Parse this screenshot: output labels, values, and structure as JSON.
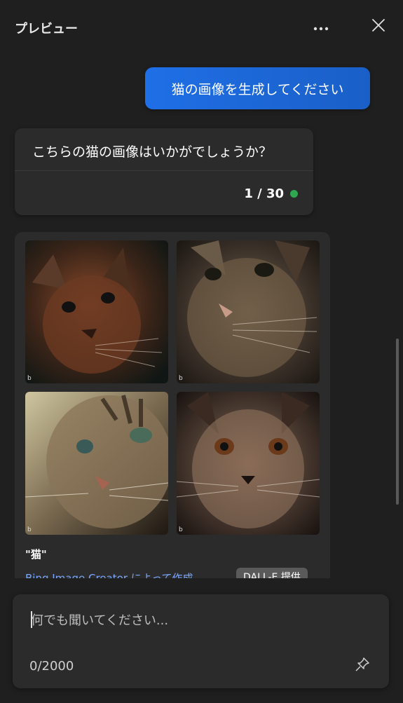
{
  "header": {
    "title": "プレビュー",
    "more_icon": "more-horizontal-icon",
    "close_icon": "close-icon"
  },
  "user_message": {
    "text": "猫の画像を生成してください"
  },
  "bot_message": {
    "text": "こちらの猫の画像はいかがでしょうか？",
    "counter": "1 / 30",
    "status_color": "#2fa84f"
  },
  "image_result": {
    "images": [
      {
        "label": "cat-image-1",
        "mark": "b"
      },
      {
        "label": "cat-image-2",
        "mark": "b"
      },
      {
        "label": "cat-image-3",
        "mark": "b"
      },
      {
        "label": "cat-image-4",
        "mark": "b"
      }
    ],
    "prompt": "\"猫\"",
    "creator_text": "Bing Image Creator によって作成",
    "badge": "DALL-E 提供"
  },
  "composer": {
    "placeholder": "何でも聞いてください...",
    "value": "",
    "char_count": "0/2000",
    "pin_icon": "pin-icon"
  },
  "colors": {
    "accent": "#1f6fe6",
    "background": "#1f1f1f",
    "card": "#2b2b2b",
    "link": "#7aa7ff"
  }
}
